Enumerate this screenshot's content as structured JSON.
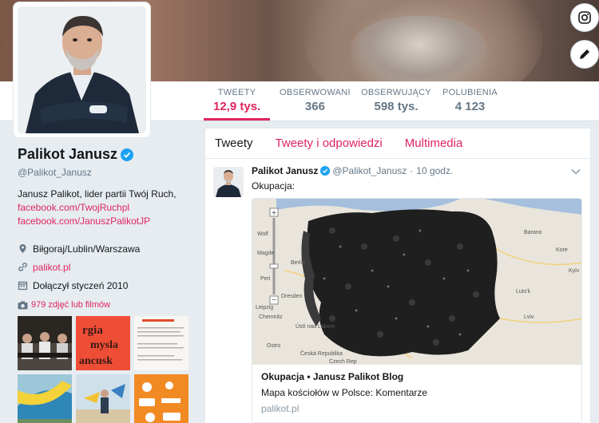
{
  "profile": {
    "name": "Palikot Janusz",
    "handle": "@Palikot_Janusz",
    "bio_text": "Janusz Palikot, lider partii Twój Ruch,",
    "bio_link1": "facebook.com/TwojRuchpl",
    "bio_link2": "facebook.com/JanuszPalikotJP",
    "location": "Biłgoraj/Lublin/Warszawa",
    "website": "palikot.pl",
    "joined": "Dołączył styczeń 2010",
    "photos_link": "979 zdjęć lub filmów"
  },
  "nav": {
    "stats": [
      {
        "label": "TWEETY",
        "value": "12,9 tys.",
        "active": true
      },
      {
        "label": "OBSERWOWANI",
        "value": "366",
        "active": false
      },
      {
        "label": "OBSERWUJĄCY",
        "value": "598 tys.",
        "active": false
      },
      {
        "label": "POLUBIENIA",
        "value": "4 123",
        "active": false
      }
    ]
  },
  "timeline": {
    "tabs": [
      "Tweety",
      "Tweety i odpowiedzi",
      "Multimedia"
    ],
    "tweet": {
      "name": "Palikot Janusz",
      "handle": "@Palikot_Janusz",
      "sep": "·",
      "time": "10 godz.",
      "text": "Okupacja:",
      "card": {
        "title": "Okupacja • Janusz Palikot Blog",
        "description": "Mapa kościołów w Polsce: Komentarze",
        "domain": "palikot.pl"
      }
    }
  },
  "map_labels": {
    "berlin": "Berlin",
    "leipzig": "Leipzig",
    "dresden": "Dresden",
    "chemnitz": "Chemnitz",
    "cesko": "Česká Republika",
    "baranov": "Barano",
    "lutsk": "Luts'k",
    "lviv": "Lviv",
    "ustnad": "Ústí nad Labem",
    "wolf": "Wolf",
    "magde": "Magde",
    "peri": "Peri",
    "ostro": "Ostro",
    "czech": "Czech Rep",
    "korosten": "Kore",
    "kyiv": "Kyiv"
  },
  "colors": {
    "accent": "#e0245e",
    "verified": "#1da1f2"
  }
}
